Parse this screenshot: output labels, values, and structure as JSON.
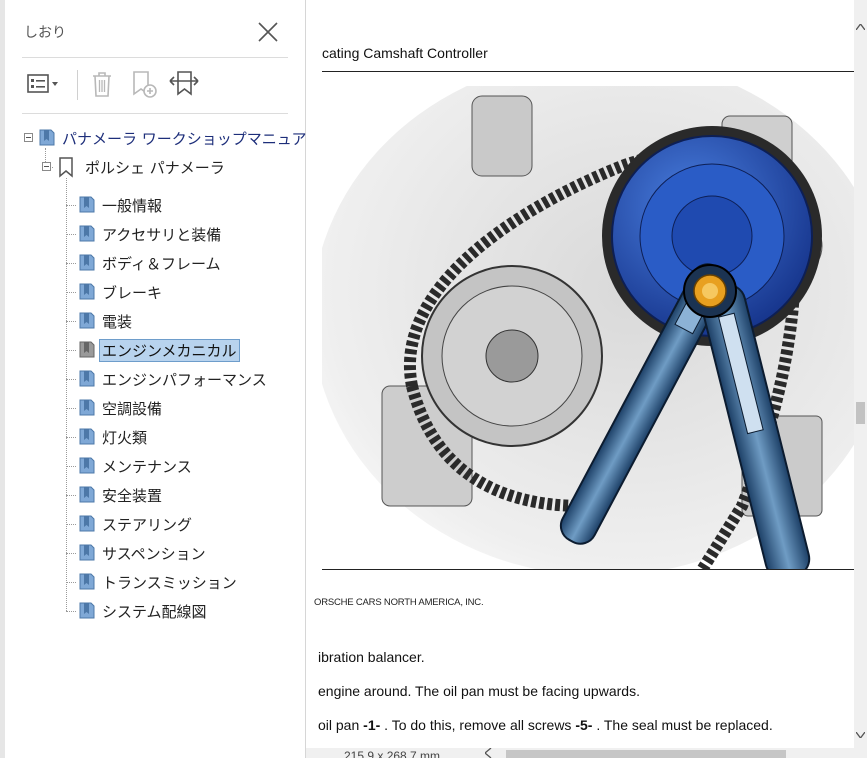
{
  "panel": {
    "title": "しおり",
    "toolbar": {
      "options_icon": "list-options-icon",
      "delete_icon": "trash-icon",
      "new_bookmark_icon": "new-bookmark-icon",
      "expand_bookmark_icon": "bookmark-expand-icon"
    }
  },
  "tree": {
    "root": "パナメーラ ワークショップマニュアル",
    "book": "ポルシェ パナメーラ",
    "items": [
      "一般情報",
      "アクセサリと装備",
      "ボディ＆フレーム",
      "ブレーキ",
      "電装",
      "エンジンメカニカル",
      "エンジンパフォーマンス",
      "空調設備",
      "灯火類",
      "メンテナンス",
      "安全装置",
      "ステアリング",
      "サスペンション",
      "トランスミッション",
      "システム配線図"
    ],
    "selected_index": 5
  },
  "document": {
    "heading": "cating Camshaft Controller",
    "copyright": "ORSCHE CARS NORTH AMERICA, INC.",
    "line1": "ibration balancer.",
    "line2": "engine around. The oil pan must be facing upwards.",
    "line3_a": "oil pan ",
    "line3_b": "-1-",
    "line3_c": " . To do this, remove all screws ",
    "line3_d": "-5-",
    "line3_e": " . The seal must be replaced."
  },
  "status": {
    "page_size": "215.9 x 268.7 mm"
  },
  "colors": {
    "selection": "#b8d3ee",
    "root_text": "#1d2e7a",
    "sprocket": "#1f4fb8",
    "wrench": "#2b5a85"
  }
}
